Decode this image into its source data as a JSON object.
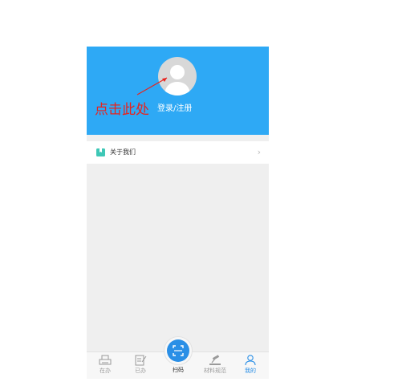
{
  "profile": {
    "login_label": "登录/注册",
    "avatar_icon": "user-avatar-icon",
    "header_color": "#2ea9f5"
  },
  "annotation": {
    "text": "点击此处",
    "color": "#e8231d"
  },
  "menu": {
    "about_label": "关于我们",
    "about_icon": "bookmark-icon",
    "chevron_icon": "chevron-right-icon"
  },
  "tabbar": {
    "tabs": [
      {
        "label": "在办",
        "icon": "printer-icon"
      },
      {
        "label": "已办",
        "icon": "document-edit-icon"
      },
      {
        "label": "扫码",
        "icon": "scan-icon"
      },
      {
        "label": "材料规范",
        "icon": "gavel-icon"
      },
      {
        "label": "我的",
        "icon": "user-icon",
        "active": true
      }
    ],
    "active_color": "#2a8fe6"
  }
}
